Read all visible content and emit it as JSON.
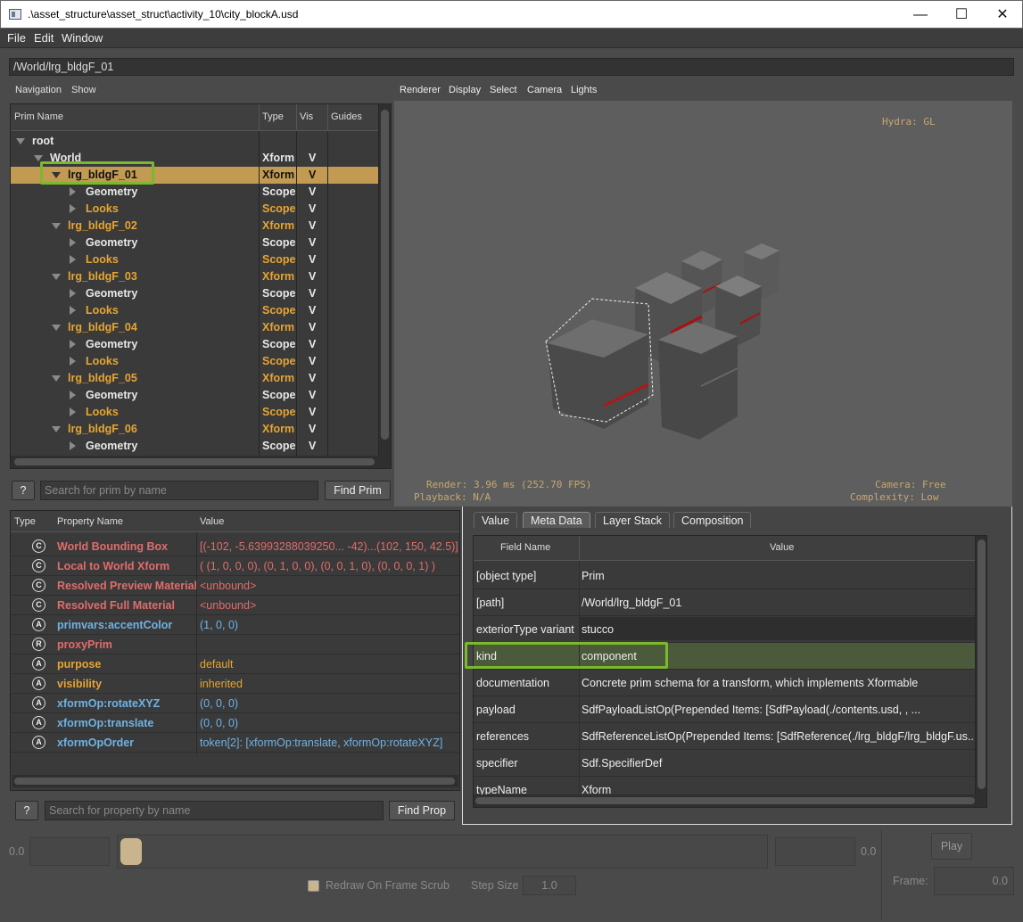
{
  "window": {
    "title": ".\\asset_structure\\asset_struct\\activity_10\\city_blockA.usd",
    "minimize": "—",
    "maximize": "☐",
    "close": "✕"
  },
  "menu": [
    "File",
    "Edit",
    "Window"
  ],
  "path": "/World/lrg_bldgF_01",
  "tree_panel": {
    "menu": [
      "Navigation",
      "Show"
    ],
    "columns": [
      "Prim Name",
      "Type",
      "Vis",
      "Guides"
    ],
    "rows": [
      {
        "name": "root",
        "type": "",
        "vis": "",
        "indent": 0,
        "expanded": true,
        "color": "#e8e8e8",
        "type_color": "#e8e8e8"
      },
      {
        "name": "World",
        "type": "Xform",
        "vis": "V",
        "indent": 1,
        "expanded": true,
        "color": "#e8e8e8",
        "type_color": "#e8e8e8"
      },
      {
        "name": "lrg_bldgF_01",
        "type": "Xform",
        "vis": "V",
        "indent": 2,
        "expanded": true,
        "selected": true,
        "color": "#111111",
        "type_color": "#111111"
      },
      {
        "name": "Geometry",
        "type": "Scope",
        "vis": "V",
        "indent": 3,
        "expanded": false,
        "color": "#e8e8e8",
        "type_color": "#e8e8e8"
      },
      {
        "name": "Looks",
        "type": "Scope",
        "vis": "V",
        "indent": 3,
        "expanded": false,
        "color": "#e6a533",
        "type_color": "#e6a533"
      },
      {
        "name": "lrg_bldgF_02",
        "type": "Xform",
        "vis": "V",
        "indent": 2,
        "expanded": true,
        "color": "#e6a533",
        "type_color": "#e6a533"
      },
      {
        "name": "Geometry",
        "type": "Scope",
        "vis": "V",
        "indent": 3,
        "expanded": false,
        "color": "#e8e8e8",
        "type_color": "#e8e8e8"
      },
      {
        "name": "Looks",
        "type": "Scope",
        "vis": "V",
        "indent": 3,
        "expanded": false,
        "color": "#e6a533",
        "type_color": "#e6a533"
      },
      {
        "name": "lrg_bldgF_03",
        "type": "Xform",
        "vis": "V",
        "indent": 2,
        "expanded": true,
        "color": "#e6a533",
        "type_color": "#e6a533"
      },
      {
        "name": "Geometry",
        "type": "Scope",
        "vis": "V",
        "indent": 3,
        "expanded": false,
        "color": "#e8e8e8",
        "type_color": "#e8e8e8"
      },
      {
        "name": "Looks",
        "type": "Scope",
        "vis": "V",
        "indent": 3,
        "expanded": false,
        "color": "#e6a533",
        "type_color": "#e6a533"
      },
      {
        "name": "lrg_bldgF_04",
        "type": "Xform",
        "vis": "V",
        "indent": 2,
        "expanded": true,
        "color": "#e6a533",
        "type_color": "#e6a533"
      },
      {
        "name": "Geometry",
        "type": "Scope",
        "vis": "V",
        "indent": 3,
        "expanded": false,
        "color": "#e8e8e8",
        "type_color": "#e8e8e8"
      },
      {
        "name": "Looks",
        "type": "Scope",
        "vis": "V",
        "indent": 3,
        "expanded": false,
        "color": "#e6a533",
        "type_color": "#e6a533"
      },
      {
        "name": "lrg_bldgF_05",
        "type": "Xform",
        "vis": "V",
        "indent": 2,
        "expanded": true,
        "color": "#e6a533",
        "type_color": "#e6a533"
      },
      {
        "name": "Geometry",
        "type": "Scope",
        "vis": "V",
        "indent": 3,
        "expanded": false,
        "color": "#e8e8e8",
        "type_color": "#e8e8e8"
      },
      {
        "name": "Looks",
        "type": "Scope",
        "vis": "V",
        "indent": 3,
        "expanded": false,
        "color": "#e6a533",
        "type_color": "#e6a533"
      },
      {
        "name": "lrg_bldgF_06",
        "type": "Xform",
        "vis": "V",
        "indent": 2,
        "expanded": true,
        "color": "#e6a533",
        "type_color": "#e6a533"
      },
      {
        "name": "Geometry",
        "type": "Scope",
        "vis": "V",
        "indent": 3,
        "expanded": false,
        "color": "#e8e8e8",
        "type_color": "#e8e8e8"
      }
    ],
    "help_label": "?",
    "search_placeholder": "Search for prim by name",
    "find_label": "Find Prim"
  },
  "viewport": {
    "menu": [
      "Renderer",
      "Display",
      "Select",
      "Camera",
      "Lights"
    ],
    "hydra": "Hydra: GL",
    "render_stats": "Render: 3.96 ms (252.70 FPS)",
    "playback": "Playback: N/A",
    "camera": "Camera: Free",
    "complexity": "Complexity: Low"
  },
  "property_panel": {
    "columns": [
      "Type",
      "Property Name",
      "Value"
    ],
    "rows": [
      {
        "icon": "C",
        "name": "World Bounding Box",
        "value": "[(-102, -5.63993288039250... -42)...(102, 150, 42.5)]",
        "color": "#e06c6c"
      },
      {
        "icon": "C",
        "name": "Local to World Xform",
        "value": "( (1, 0, 0, 0), (0, 1, 0, 0), (0, 0, 1, 0), (0, 0, 0, 1) )",
        "color": "#e06c6c"
      },
      {
        "icon": "C",
        "name": "Resolved Preview Material",
        "value": "<unbound>",
        "color": "#e06c6c"
      },
      {
        "icon": "C",
        "name": "Resolved Full Material",
        "value": "<unbound>",
        "color": "#e06c6c"
      },
      {
        "icon": "A",
        "name": "primvars:accentColor",
        "value": "(1, 0, 0)",
        "color": "#6fb3e6"
      },
      {
        "icon": "R",
        "name": "proxyPrim",
        "value": "",
        "color": "#e06c6c"
      },
      {
        "icon": "A",
        "name": "purpose",
        "value": "default",
        "color": "#e6a533"
      },
      {
        "icon": "A",
        "name": "visibility",
        "value": "inherited",
        "color": "#e6a533"
      },
      {
        "icon": "A",
        "name": "xformOp:rotateXYZ",
        "value": "(0, 0, 0)",
        "color": "#6fb3e6"
      },
      {
        "icon": "A",
        "name": "xformOp:translate",
        "value": "(0, 0, 0)",
        "color": "#6fb3e6"
      },
      {
        "icon": "A",
        "name": "xformOpOrder",
        "value": "token[2]: [xformOp:translate, xformOp:rotateXYZ]",
        "color": "#6fb3e6"
      }
    ],
    "help_label": "?",
    "search_placeholder": "Search for property by name",
    "find_label": "Find Prop"
  },
  "meta_panel": {
    "tabs": [
      "Value",
      "Meta Data",
      "Layer Stack",
      "Composition"
    ],
    "active_tab": "Meta Data",
    "columns": [
      "Field Name",
      "Value"
    ],
    "rows": [
      {
        "field": "[object type]",
        "value": "Prim"
      },
      {
        "field": "[path]",
        "value": "/World/lrg_bldgF_01"
      },
      {
        "field": "exteriorType variant",
        "value": "stucco",
        "dropdown": true
      },
      {
        "field": "kind",
        "value": "component",
        "highlight": true
      },
      {
        "field": "documentation",
        "value": "Concrete prim schema for a transform, which implements Xformable"
      },
      {
        "field": "payload",
        "value": "SdfPayloadListOp(Prepended Items: [SdfPayload(./contents.usd, , ..."
      },
      {
        "field": "references",
        "value": "SdfReferenceListOp(Prepended Items: [SdfReference(./lrg_bldgF/lrg_bldgF.us..."
      },
      {
        "field": "specifier",
        "value": "Sdf.SpecifierDef"
      },
      {
        "field": "typeName",
        "value": "Xform"
      }
    ]
  },
  "timeline": {
    "start_value": "0.0",
    "end_value": "0.0",
    "play_label": "Play",
    "frame_label": "Frame:",
    "frame_value": "0.0",
    "redraw_label": "Redraw On Frame Scrub",
    "step_label": "Step Size",
    "step_value": "1.0"
  },
  "colors": {
    "selection": "#c29a52",
    "highlight_box": "#7ab92b",
    "viewport_bg": "#5e5e5e"
  }
}
